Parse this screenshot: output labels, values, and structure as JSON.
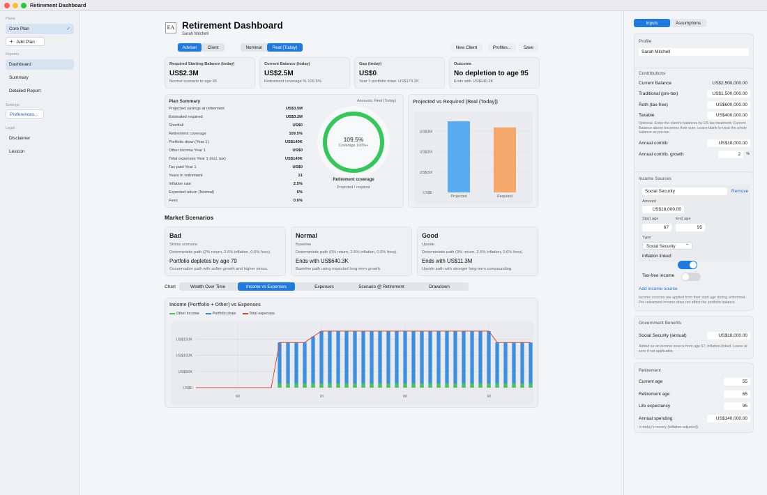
{
  "window": {
    "title": "Retirement Dashboard"
  },
  "sidebar": {
    "plans_label": "Plans",
    "core_plan": "Core Plan",
    "check": "✓",
    "add_plan": "Add Plan",
    "reports_label": "Reports",
    "reports": [
      "Dashboard",
      "Summary",
      "Detailed Report"
    ],
    "settings_label": "Settings",
    "preferences": "Preferences...",
    "legal_label": "Legal",
    "legal": [
      "Disclaimer",
      "Lexicon"
    ]
  },
  "header": {
    "logo_text": "EA",
    "title": "Retirement Dashboard",
    "client_name": "Sarah Mitchell",
    "view_tabs": [
      "Adviser",
      "Client"
    ],
    "mode_tabs": [
      "Nominal",
      "Real (Today)"
    ],
    "actions": [
      "New Client",
      "Profiles...",
      "Save"
    ]
  },
  "kpis": [
    {
      "label": "Required Starting Balance (today)",
      "value": "US$2.3M",
      "sub": "Normal scenario to age 95"
    },
    {
      "label": "Current Balance (today)",
      "value": "US$2.5M",
      "sub": "Retirement coverage % 109.5%"
    },
    {
      "label": "Gap (today)",
      "value": "US$0",
      "sub": "Year 1 portfolio draw: US$179.2K"
    },
    {
      "label": "Outcome",
      "value": "No depletion to age 95",
      "sub": "Ends with US$640.3K"
    }
  ],
  "plan_summary": {
    "title": "Plan Summary",
    "amounts_note": "Amounts: Real (Today)",
    "rows": [
      {
        "label": "Projected savings at retirement",
        "value": "US$3.5M"
      },
      {
        "label": "Estimated required",
        "value": "US$3.2M"
      },
      {
        "label": "Shortfall",
        "value": "US$0"
      },
      {
        "label": "Retirement coverage",
        "value": "109.5%"
      },
      {
        "label": "Portfolio draw (Year 1)",
        "value": "US$140K"
      },
      {
        "label": "Other income Year 1",
        "value": "US$0"
      },
      {
        "label": "Total expenses Year 1 (incl. tax)",
        "value": "US$140K"
      },
      {
        "label": "Tax paid Year 1",
        "value": "US$0"
      },
      {
        "label": "Years in retirement",
        "value": "31"
      },
      {
        "label": "Inflation rate",
        "value": "2.5%"
      },
      {
        "label": "Expected return (Normal)",
        "value": "6%"
      },
      {
        "label": "Fees",
        "value": "0.6%"
      }
    ],
    "ring_value": "109.5%",
    "ring_sub": "Coverage 100%+",
    "ring_fill": 1.0,
    "ring_label": "Retirement coverage",
    "ring_caption": "Projected / required"
  },
  "projected_chart": {
    "title": "Projected vs Required (Real (Today))",
    "yticks": [
      "US$3M",
      "US$2M",
      "US$1M",
      "US$0"
    ]
  },
  "market": {
    "title": "Market Scenarios",
    "scenarios": [
      {
        "title": "Bad",
        "kind": "Stress scenario",
        "desc": "Deterministic path (2% return, 2.5% inflation, 0.6% fees).",
        "main": "Portfolio depletes by age 79",
        "foot": "Conservative path with softer growth and higher stress."
      },
      {
        "title": "Normal",
        "kind": "Baseline",
        "desc": "Deterministic path (6% return, 2.5% inflation, 0.6% fees).",
        "main": "Ends with US$640.3K",
        "foot": "Baseline path using expected long-term growth."
      },
      {
        "title": "Good",
        "kind": "Upside",
        "desc": "Deterministic path (9% return, 2.5% inflation, 0.6% fees).",
        "main": "Ends with US$11.3M",
        "foot": "Upside path with stronger long-term compounding."
      }
    ]
  },
  "chart_tabs": {
    "label": "Chart",
    "tabs": [
      "Wealth Over Time",
      "Income vs Expenses",
      "Expenses",
      "Scenario @ Retirement",
      "Drawdown"
    ]
  },
  "income_chart": {
    "title": "Income (Portfolio + Other) vs Expenses",
    "legend": [
      "Other income",
      "Portfolio draw",
      "Total expenses"
    ],
    "yticks": [
      "US$150K",
      "US$100K",
      "US$50K",
      "US$0"
    ]
  },
  "chart_data": [
    {
      "type": "bar",
      "title": "Projected vs Required (Real (Today))",
      "categories": [
        "Projected",
        "Required"
      ],
      "values": [
        3.5,
        3.2
      ],
      "unit": "US$M",
      "ylim": [
        0,
        3.5
      ],
      "colors": [
        "#5aacf2",
        "#f6a86a"
      ]
    },
    {
      "type": "bar",
      "title": "Income (Portfolio + Other) vs Expenses",
      "x_start": 55,
      "x_end": 95,
      "xticks": [
        60,
        70,
        80,
        90
      ],
      "ylim": [
        0,
        190000
      ],
      "series": [
        {
          "name": "Other income",
          "color": "#4cc45a",
          "values": [
            0,
            0,
            0,
            0,
            0,
            0,
            0,
            0,
            0,
            0,
            0,
            0,
            0,
            0,
            0,
            0,
            0,
            0,
            0,
            0,
            0,
            0,
            0,
            0,
            0,
            0,
            0,
            0,
            0,
            0,
            0,
            0,
            0,
            0,
            0,
            0,
            0,
            0,
            0,
            0,
            0
          ]
        },
        {
          "name": "Portfolio draw",
          "color": "#3b8fe0",
          "values": [
            0,
            0,
            0,
            0,
            0,
            0,
            0,
            0,
            0,
            0,
            140000,
            140000,
            140000,
            140000,
            158000,
            175000,
            175000,
            175000,
            175000,
            175000,
            175000,
            175000,
            175000,
            175000,
            175000,
            175000,
            175000,
            175000,
            175000,
            175000,
            175000,
            175000,
            175000,
            175000,
            175000,
            175000,
            140000,
            140000,
            140000,
            140000,
            140000
          ]
        },
        {
          "name": "Total expenses",
          "color": "#e0473d",
          "values": [
            0,
            0,
            0,
            0,
            0,
            0,
            0,
            0,
            0,
            0,
            140000,
            140000,
            140000,
            140000,
            158000,
            175000,
            175000,
            175000,
            175000,
            175000,
            175000,
            175000,
            175000,
            175000,
            175000,
            175000,
            175000,
            175000,
            175000,
            175000,
            175000,
            175000,
            175000,
            175000,
            175000,
            175000,
            140000,
            140000,
            140000,
            140000,
            140000
          ]
        }
      ]
    }
  ],
  "right_panel": {
    "tabs": [
      "Inputs",
      "Assumptions"
    ],
    "profile": {
      "title": "Profile",
      "name": "Sarah Mitchell"
    },
    "contributions": {
      "title": "Contributions",
      "current_balance_label": "Current Balance",
      "current_balance_value": "US$2,500,000.00",
      "traditional_label": "Traditional (pre-tax)",
      "traditional_value": "US$1,500,000.00",
      "roth_label": "Roth (tax-free)",
      "roth_value": "US$600,000.00",
      "taxable_label": "Taxable",
      "taxable_value": "US$400,000.00",
      "note": "Optional. Enter the client's balances by US tax treatment; Current Balance above becomes their sum. Leave blank to treat the whole balance as pre-tax.",
      "annual_label": "Annual contrib",
      "annual_value": "US$18,000.00",
      "growth_label": "Annual contrib. growth",
      "growth_value": "2",
      "growth_unit": "%"
    },
    "income_sources": {
      "title": "Income Sources",
      "source_name": "Social Security",
      "remove": "Remove",
      "amount_label": "Amount",
      "amount_value": "US$18,000.00",
      "start_label": "Start age",
      "start_value": "67",
      "end_label": "End age",
      "end_value": "95",
      "type_label": "Type",
      "type_value": "Social Security",
      "inflation_label": "Inflation linked",
      "taxfree_label": "Tax-free income",
      "add_link": "Add income source",
      "note": "Income sources are applied from their start age during retirement. Pre-retirement income does not affect the portfolio balance."
    },
    "gov": {
      "title": "Government Benefits",
      "ss_label": "Social Security (annual)",
      "ss_value": "US$18,000.00",
      "note": "Added as an income source from age 67, inflation-linked. Leave at zero if not applicable."
    },
    "retirement": {
      "title": "Retirement",
      "current_age_label": "Current age",
      "current_age_value": "55",
      "ret_age_label": "Retirement age",
      "ret_age_value": "65",
      "life_label": "Life expectancy",
      "life_value": "95",
      "spend_label": "Annual spending",
      "spend_value": "US$140,000.00",
      "spend_note": "In today's money (inflation-adjusted)."
    }
  }
}
